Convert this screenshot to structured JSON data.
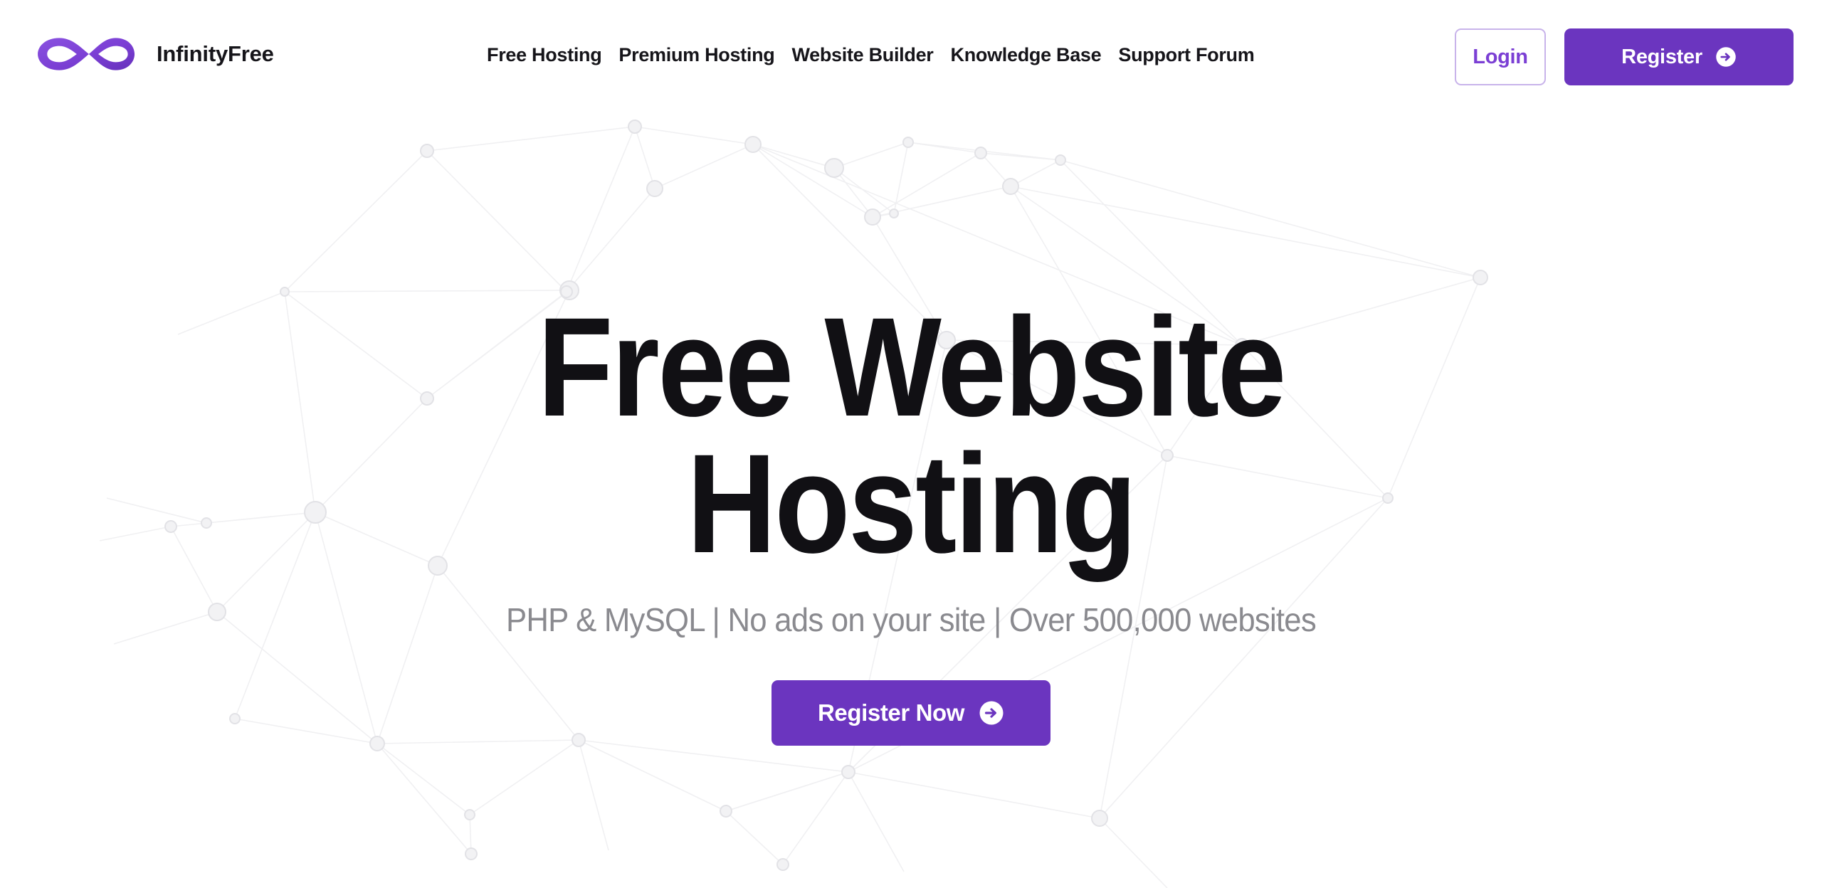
{
  "brand": {
    "name": "InfinityFree",
    "logo_icon": "infinity-logo-icon",
    "logo_color": "#7b3fd4"
  },
  "nav": {
    "items": [
      {
        "label": "Free Hosting"
      },
      {
        "label": "Premium Hosting"
      },
      {
        "label": "Website Builder"
      },
      {
        "label": "Knowledge Base"
      },
      {
        "label": "Support Forum"
      }
    ]
  },
  "header_actions": {
    "login_label": "Login",
    "register_label": "Register",
    "register_icon": "arrow-right-circle-icon",
    "login_text_color": "#7b3fd4",
    "login_border_color": "#c8b3ea",
    "register_bg_color": "#6b35bf"
  },
  "hero": {
    "title_line1": "Free Website",
    "title_line2": "Hosting",
    "subtitle": "PHP & MySQL | No ads on your site | Over 500,000 websites",
    "cta_label": "Register Now",
    "cta_icon": "arrow-right-circle-icon",
    "cta_bg_color": "#6b35bf",
    "title_color": "#111014",
    "subtitle_color": "#8a8a8f"
  },
  "background": {
    "pattern": "network-constellation-pattern",
    "node_fill": "#f2f2f4",
    "node_stroke": "#e2e2e6",
    "line_color": "#f0f0f2"
  }
}
